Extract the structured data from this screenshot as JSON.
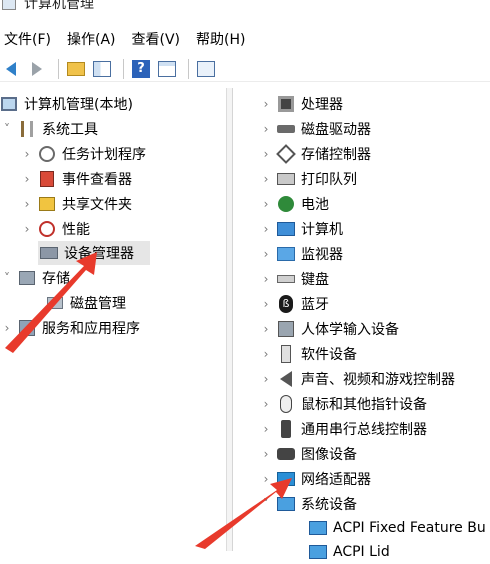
{
  "window": {
    "title": "计算机管理"
  },
  "menu": [
    "文件(F)",
    "操作(A)",
    "查看(V)",
    "帮助(H)"
  ],
  "toolbar": {
    "buttons": [
      "back-arrow-icon",
      "forward-arrow-icon",
      "up-folder-icon",
      "show-pane-icon",
      "help-icon",
      "properties-icon",
      "monitor-icon"
    ]
  },
  "left_tree": [
    {
      "label": "计算机管理(本地)",
      "icon": "computer-management-icon",
      "chev": "",
      "depth": 0
    },
    {
      "label": "系统工具",
      "icon": "system-tools-icon",
      "chev": "˅",
      "depth": 1
    },
    {
      "label": "任务计划程序",
      "icon": "task-scheduler-icon",
      "chev": "›",
      "depth": 2
    },
    {
      "label": "事件查看器",
      "icon": "event-viewer-icon",
      "chev": "›",
      "depth": 2
    },
    {
      "label": "共享文件夹",
      "icon": "shared-folders-icon",
      "chev": "›",
      "depth": 2
    },
    {
      "label": "性能",
      "icon": "performance-icon",
      "chev": "›",
      "depth": 2
    },
    {
      "label": "设备管理器",
      "icon": "device-manager-icon",
      "chev": "",
      "depth": 2,
      "selected": true
    },
    {
      "label": "存储",
      "icon": "storage-icon",
      "chev": "˅",
      "depth": 1
    },
    {
      "label": "磁盘管理",
      "icon": "disk-management-icon",
      "chev": "",
      "depth": 2
    },
    {
      "label": "服务和应用程序",
      "icon": "services-apps-icon",
      "chev": "›",
      "depth": 1
    }
  ],
  "right_tree": [
    {
      "label": "处理器",
      "icon": "processor-icon",
      "chev": "›"
    },
    {
      "label": "磁盘驱动器",
      "icon": "disk-drive-icon",
      "chev": "›"
    },
    {
      "label": "存储控制器",
      "icon": "storage-controller-icon",
      "chev": "›"
    },
    {
      "label": "打印队列",
      "icon": "printer-icon",
      "chev": "›"
    },
    {
      "label": "电池",
      "icon": "battery-icon",
      "chev": "›"
    },
    {
      "label": "计算机",
      "icon": "computer-icon",
      "chev": "›"
    },
    {
      "label": "监视器",
      "icon": "monitor-icon",
      "chev": "›"
    },
    {
      "label": "键盘",
      "icon": "keyboard-icon",
      "chev": "›"
    },
    {
      "label": "蓝牙",
      "icon": "bluetooth-icon",
      "chev": "›"
    },
    {
      "label": "人体学输入设备",
      "icon": "hid-icon",
      "chev": "›"
    },
    {
      "label": "软件设备",
      "icon": "software-device-icon",
      "chev": "›"
    },
    {
      "label": "声音、视频和游戏控制器",
      "icon": "sound-icon",
      "chev": "›"
    },
    {
      "label": "鼠标和其他指针设备",
      "icon": "mouse-icon",
      "chev": "›"
    },
    {
      "label": "通用串行总线控制器",
      "icon": "usb-icon",
      "chev": "›"
    },
    {
      "label": "图像设备",
      "icon": "camera-icon",
      "chev": "›"
    },
    {
      "label": "网络适配器",
      "icon": "network-adapter-icon",
      "chev": "›"
    },
    {
      "label": "系统设备",
      "icon": "system-device-icon",
      "chev": "˅"
    },
    {
      "label": "ACPI Fixed Feature Bu",
      "icon": "acpi-device-icon",
      "chev": ""
    },
    {
      "label": "ACPI Lid",
      "icon": "acpi-device-icon",
      "chev": ""
    }
  ],
  "colors": {
    "annotation_arrow": "#e83a2c",
    "selection": "#e6e6e6"
  }
}
